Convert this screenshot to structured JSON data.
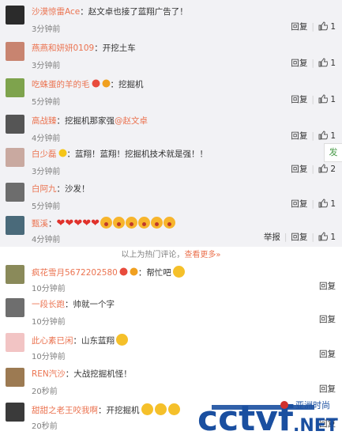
{
  "comments": [
    {
      "user": "沙漠惊雷Ace",
      "text": "赵文卓也接了蓝翔广告了！",
      "time": "3分钟前",
      "reply": "回复",
      "likes": "1",
      "avatar": "#2b2b2b",
      "hot": true
    },
    {
      "user": "燕燕和妍妍0109",
      "text": "开挖土车",
      "time": "3分钟前",
      "reply": "回复",
      "likes": "1",
      "avatar": "#c88470",
      "hot": true
    },
    {
      "user": "吃蛛蛋的羊的毛",
      "text": "挖掘机",
      "time": "5分钟前",
      "reply": "回复",
      "likes": "1",
      "avatar": "#7ea34d",
      "hot": true
    },
    {
      "user": "高战臻",
      "text": "挖掘机那家强",
      "mention": "@赵文卓",
      "time": "4分钟前",
      "reply": "回复",
      "likes": "1",
      "avatar": "#555555",
      "hot": true
    },
    {
      "user": "白少磊",
      "text": "蓝翔！蓝翔！挖掘机技术就是强！！",
      "time": "3分钟前",
      "reply": "回复",
      "likes": "2",
      "avatar": "#c9a9a0",
      "hot": true
    },
    {
      "user": "白阿九",
      "text": "沙发！",
      "time": "5分钟前",
      "reply": "回复",
      "likes": "1",
      "avatar": "#6d6d6d",
      "hot": true
    },
    {
      "user": "甄溪",
      "text": "",
      "time": "4分钟前",
      "report": "举报",
      "reply": "回复",
      "likes": "1",
      "avatar": "#4a6a7a",
      "hot": true
    },
    {
      "user": "疯花雪月5672202580",
      "text": "帮忙吧",
      "time": "10分钟前",
      "reply": "回复",
      "likes": "",
      "avatar": "#8a8a5a",
      "hot": false
    },
    {
      "user": "一段长跑",
      "text": "帅就一个字",
      "time": "10分钟前",
      "reply": "回复",
      "likes": "",
      "avatar": "#6e6e6e",
      "hot": false
    },
    {
      "user": "此心素已闲",
      "text": "山东蓝翔",
      "time": "10分钟前",
      "reply": "回复",
      "likes": "",
      "avatar": "#f2c4c4",
      "hot": false
    },
    {
      "user": "REN汽沙",
      "text": "大战挖掘机怪！",
      "time": "20秒前",
      "reply": "回复",
      "likes": "",
      "avatar": "#9c7a52",
      "hot": false
    },
    {
      "user": "甜甜之老王咬我啊",
      "text": "开挖掘机",
      "time": "20秒前",
      "reply": "回复",
      "likes": "",
      "avatar": "#3a3a3a",
      "hot": false
    }
  ],
  "divider": {
    "text": "以上为热门评论，",
    "more": "查看更多»"
  },
  "side_button": "发",
  "watermark": {
    "logo": "cctvf.NET",
    "sub": "亚洲时尚"
  },
  "colors": {
    "accent": "#eb7350",
    "hot_bg": "#f2f2f5",
    "watermark_blue": "#1a4fa0"
  }
}
